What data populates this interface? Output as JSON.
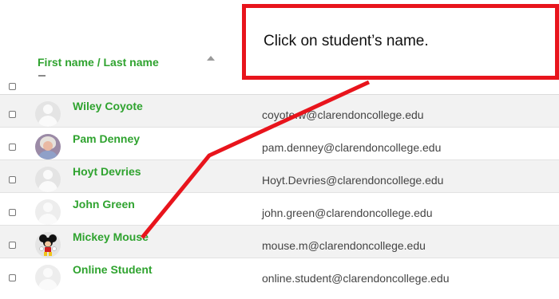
{
  "table": {
    "header": {
      "first_name": "First name",
      "separator": " / ",
      "last_name": "Last name",
      "sort_icon": "sort-ascending-icon"
    },
    "rows": [
      {
        "name": "Wiley Coyote",
        "email": "coyote.w@clarendoncollege.edu",
        "avatar": "default-user-icon"
      },
      {
        "name": "Pam Denney",
        "email": "pam.denney@clarendoncollege.edu",
        "avatar": "user-photo"
      },
      {
        "name": "Hoyt Devries",
        "email": "Hoyt.Devries@clarendoncollege.edu",
        "avatar": "default-user-icon"
      },
      {
        "name": "John Green",
        "email": "john.green@clarendoncollege.edu",
        "avatar": "default-user-icon"
      },
      {
        "name": "Mickey Mouse",
        "email": "mouse.m@clarendoncollege.edu",
        "avatar": "mickey-mouse-image"
      },
      {
        "name": "Online Student",
        "email": "online.student@clarendoncollege.edu",
        "avatar": "default-user-icon"
      }
    ]
  },
  "annotation": {
    "text": "Click on student’s name.",
    "color": "#e8141c"
  },
  "colors": {
    "link_green": "#2fa32f",
    "row_shade": "#f2f2f2"
  }
}
